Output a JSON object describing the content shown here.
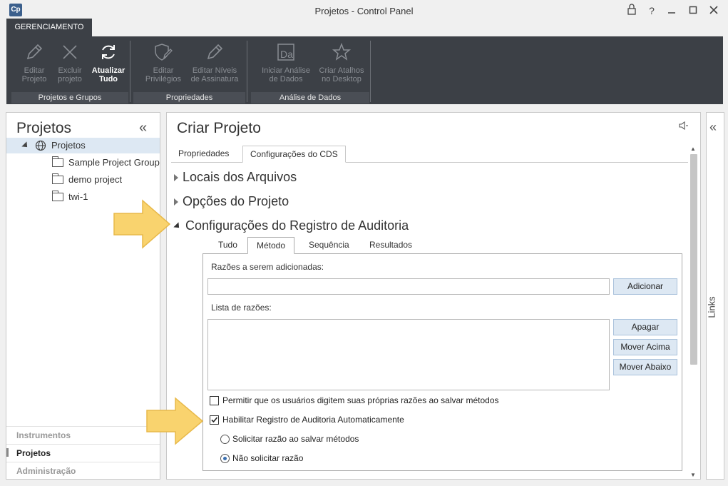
{
  "window": {
    "app_icon": "Cp",
    "title": "Projetos - Control Panel",
    "buttons": [
      "lock-icon",
      "help-icon",
      "minimize-icon",
      "maximize-icon",
      "close-icon"
    ]
  },
  "ribbon": {
    "tab": "GERENCIAMENTO",
    "groups": [
      {
        "label": "Projetos e Grupos"
      },
      {
        "label": "Propriedades"
      },
      {
        "label": "Análise de Dados"
      }
    ],
    "buttons": {
      "edit_project": {
        "line1": "Editar",
        "line2": "Projeto"
      },
      "delete_project": {
        "line1": "Excluir",
        "line2": "projeto"
      },
      "refresh_all": {
        "line1": "Atualizar",
        "line2": "Tudo"
      },
      "edit_privileges": {
        "line1": "Editar",
        "line2": "Privilégios"
      },
      "edit_signature": {
        "line1": "Editar Níveis",
        "line2": "de Assinatura"
      },
      "start_analysis": {
        "line1": "Iniciar Análise",
        "line2": "de Dados"
      },
      "create_shortcuts": {
        "line1": "Criar Atalhos",
        "line2": "no Desktop"
      }
    },
    "icons": [
      "pencil-icon",
      "x-icon",
      "refresh-icon",
      "shield-pencil-icon",
      "pencil-icon",
      "data-analysis-icon",
      "star-icon"
    ]
  },
  "left_panel": {
    "title": "Projetos",
    "tree": {
      "root": "Projetos",
      "children": [
        "Sample Project Group",
        "demo project",
        "twi-1"
      ]
    },
    "nav": [
      {
        "label": "Instrumentos",
        "active": false
      },
      {
        "label": "Projetos",
        "active": true
      },
      {
        "label": "Administração",
        "active": false
      }
    ]
  },
  "main_panel": {
    "title": "Criar Projeto",
    "tabs": [
      {
        "label": "Propriedades",
        "selected": false
      },
      {
        "label": "Configurações do CDS",
        "selected": true
      }
    ],
    "sections": [
      {
        "label": "Locais dos Arquivos",
        "expanded": false
      },
      {
        "label": "Opções do Projeto",
        "expanded": false
      },
      {
        "label": "Configurações do Registro de Auditoria",
        "expanded": true
      }
    ],
    "sub_tabs": [
      {
        "label": "Tudo",
        "selected": false
      },
      {
        "label": "Método",
        "selected": true
      },
      {
        "label": "Sequência",
        "selected": false
      },
      {
        "label": "Resultados",
        "selected": false
      }
    ],
    "reasons_to_add_label": "Razões a serem adicionadas:",
    "reasons_to_add_value": "",
    "add_button": "Adicionar",
    "reasons_list_label": "Lista de razões:",
    "delete_button": "Apagar",
    "move_up_button": "Mover Acima",
    "move_down_button": "Mover Abaixo",
    "options": {
      "allow_own_reasons": {
        "label": "Permitir que os usuários digitem suas próprias razões ao salvar métodos",
        "checked": false
      },
      "enable_audit": {
        "label": "Habilitar Registro de Auditoria Automaticamente",
        "checked": true
      },
      "ask_reason": {
        "label": "Solicitar razão ao salvar métodos",
        "selected": false
      },
      "no_reason": {
        "label": "Não solicitar razão",
        "selected": true
      }
    }
  },
  "links_panel": {
    "label": "Links"
  },
  "colors": {
    "ribbon_bg": "#3c4046",
    "selection_bg": "#dde8f3",
    "button_bg": "#dde8f3",
    "annotation_arrow": "#f9d36e"
  }
}
